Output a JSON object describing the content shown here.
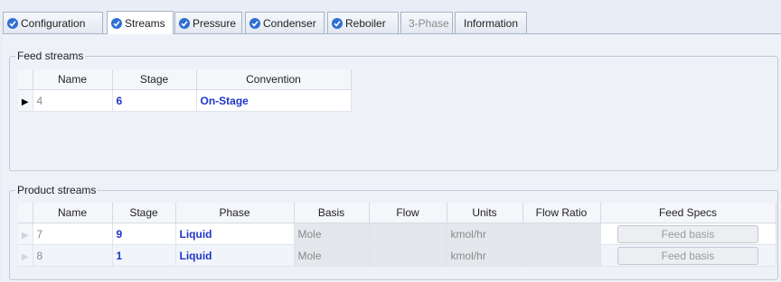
{
  "tabs": [
    {
      "label": "Configuration",
      "icon": "check-circle-icon",
      "state": "normal"
    },
    {
      "label": "Streams",
      "icon": "check-circle-icon",
      "state": "active"
    },
    {
      "label": "Pressure",
      "icon": "check-circle-icon",
      "state": "normal"
    },
    {
      "label": "Condenser",
      "icon": "check-circle-icon",
      "state": "normal"
    },
    {
      "label": "Reboiler",
      "icon": "check-circle-icon",
      "state": "normal"
    },
    {
      "label": "3-Phase",
      "icon": "",
      "state": "disabled"
    },
    {
      "label": "Information",
      "icon": "",
      "state": "normal"
    }
  ],
  "feed_streams": {
    "title": "Feed streams",
    "columns": [
      "Name",
      "Stage",
      "Convention"
    ],
    "rows": [
      {
        "name": "4",
        "stage": "6",
        "convention": "On-Stage"
      }
    ]
  },
  "product_streams": {
    "title": "Product streams",
    "columns": [
      "Name",
      "Stage",
      "Phase",
      "Basis",
      "Flow",
      "Units",
      "Flow Ratio",
      "Feed Specs"
    ],
    "rows": [
      {
        "name": "7",
        "stage": "9",
        "phase": "Liquid",
        "basis": "Mole",
        "flow": "",
        "units": "kmol/hr",
        "flow_ratio": "",
        "feed_specs": "Feed basis"
      },
      {
        "name": "8",
        "stage": "1",
        "phase": "Liquid",
        "basis": "Mole",
        "flow": "",
        "units": "kmol/hr",
        "flow_ratio": "",
        "feed_specs": "Feed basis"
      }
    ]
  },
  "colors": {
    "accent_blue": "#1f35c8",
    "icon_blue": "#2f6fd1",
    "panel_bg": "#eef1f7"
  }
}
